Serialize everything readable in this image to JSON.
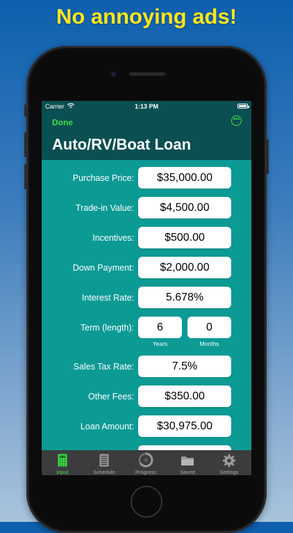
{
  "promo": {
    "headline": "No annoying ads!"
  },
  "status_bar": {
    "carrier": "Carrier",
    "time": "1:13 PM"
  },
  "nav": {
    "done_label": "Done",
    "title": "Auto/RV/Boat Loan",
    "more_icon": "more-icon"
  },
  "form": {
    "purchase_price": {
      "label": "Purchase Price:",
      "value": "$35,000.00"
    },
    "trade_in": {
      "label": "Trade-in Value:",
      "value": "$4,500.00"
    },
    "incentives": {
      "label": "Incentives:",
      "value": "$500.00"
    },
    "down_payment": {
      "label": "Down Payment:",
      "value": "$2,000.00"
    },
    "interest_rate": {
      "label": "Interest Rate:",
      "value": "5.678%"
    },
    "term": {
      "label": "Term (length):",
      "years": "6",
      "years_label": "Years",
      "months": "0",
      "months_label": "Months"
    },
    "sales_tax": {
      "label": "Sales Tax Rate:",
      "value": "7.5%"
    },
    "other_fees": {
      "label": "Other Fees:",
      "value": "$350.00"
    },
    "loan_amount": {
      "label": "Loan Amount:",
      "value": "$30,975.00"
    }
  },
  "tabbar": {
    "items": [
      {
        "label": "Input",
        "icon": "calculator-icon",
        "active": true
      },
      {
        "label": "Schedule",
        "icon": "schedule-icon",
        "active": false
      },
      {
        "label": "Progress",
        "icon": "progress-icon",
        "active": false
      },
      {
        "label": "Saved",
        "icon": "folder-icon",
        "active": false
      },
      {
        "label": "Settings",
        "icon": "gear-icon",
        "active": false
      }
    ]
  },
  "colors": {
    "accent": "#3de04a",
    "teal": "#0c9a95",
    "header": "#0a4f52",
    "headline": "#ffe61a"
  }
}
